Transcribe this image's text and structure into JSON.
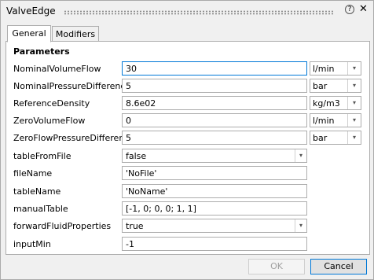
{
  "window": {
    "title": "ValveEdge",
    "help_glyph": "?",
    "close_glyph": "✕"
  },
  "tabs": [
    {
      "label": "General"
    },
    {
      "label": "Modifiers"
    }
  ],
  "section_title": "Parameters",
  "params": [
    {
      "label": "NominalVolumeFlow",
      "value": "30",
      "unit": "l/min"
    },
    {
      "label": "NominalPressureDifference",
      "value": "5",
      "unit": "bar"
    },
    {
      "label": "ReferenceDensity",
      "value": "8.6e02",
      "unit": "kg/m3"
    },
    {
      "label": "ZeroVolumeFlow",
      "value": "0",
      "unit": "l/min"
    },
    {
      "label": "ZeroFlowPressureDifference",
      "value": "5",
      "unit": "bar"
    },
    {
      "label": "tableFromFile",
      "value": "false"
    },
    {
      "label": "fileName",
      "value": "'NoFile'"
    },
    {
      "label": "tableName",
      "value": "'NoName'"
    },
    {
      "label": "manualTable",
      "value": "[-1, 0; 0, 0; 1, 1]"
    },
    {
      "label": "forwardFluidProperties",
      "value": "true"
    },
    {
      "label": "inputMin",
      "value": "-1"
    }
  ],
  "buttons": {
    "ok": "OK",
    "cancel": "Cancel"
  },
  "dropdown_glyph": "▾"
}
